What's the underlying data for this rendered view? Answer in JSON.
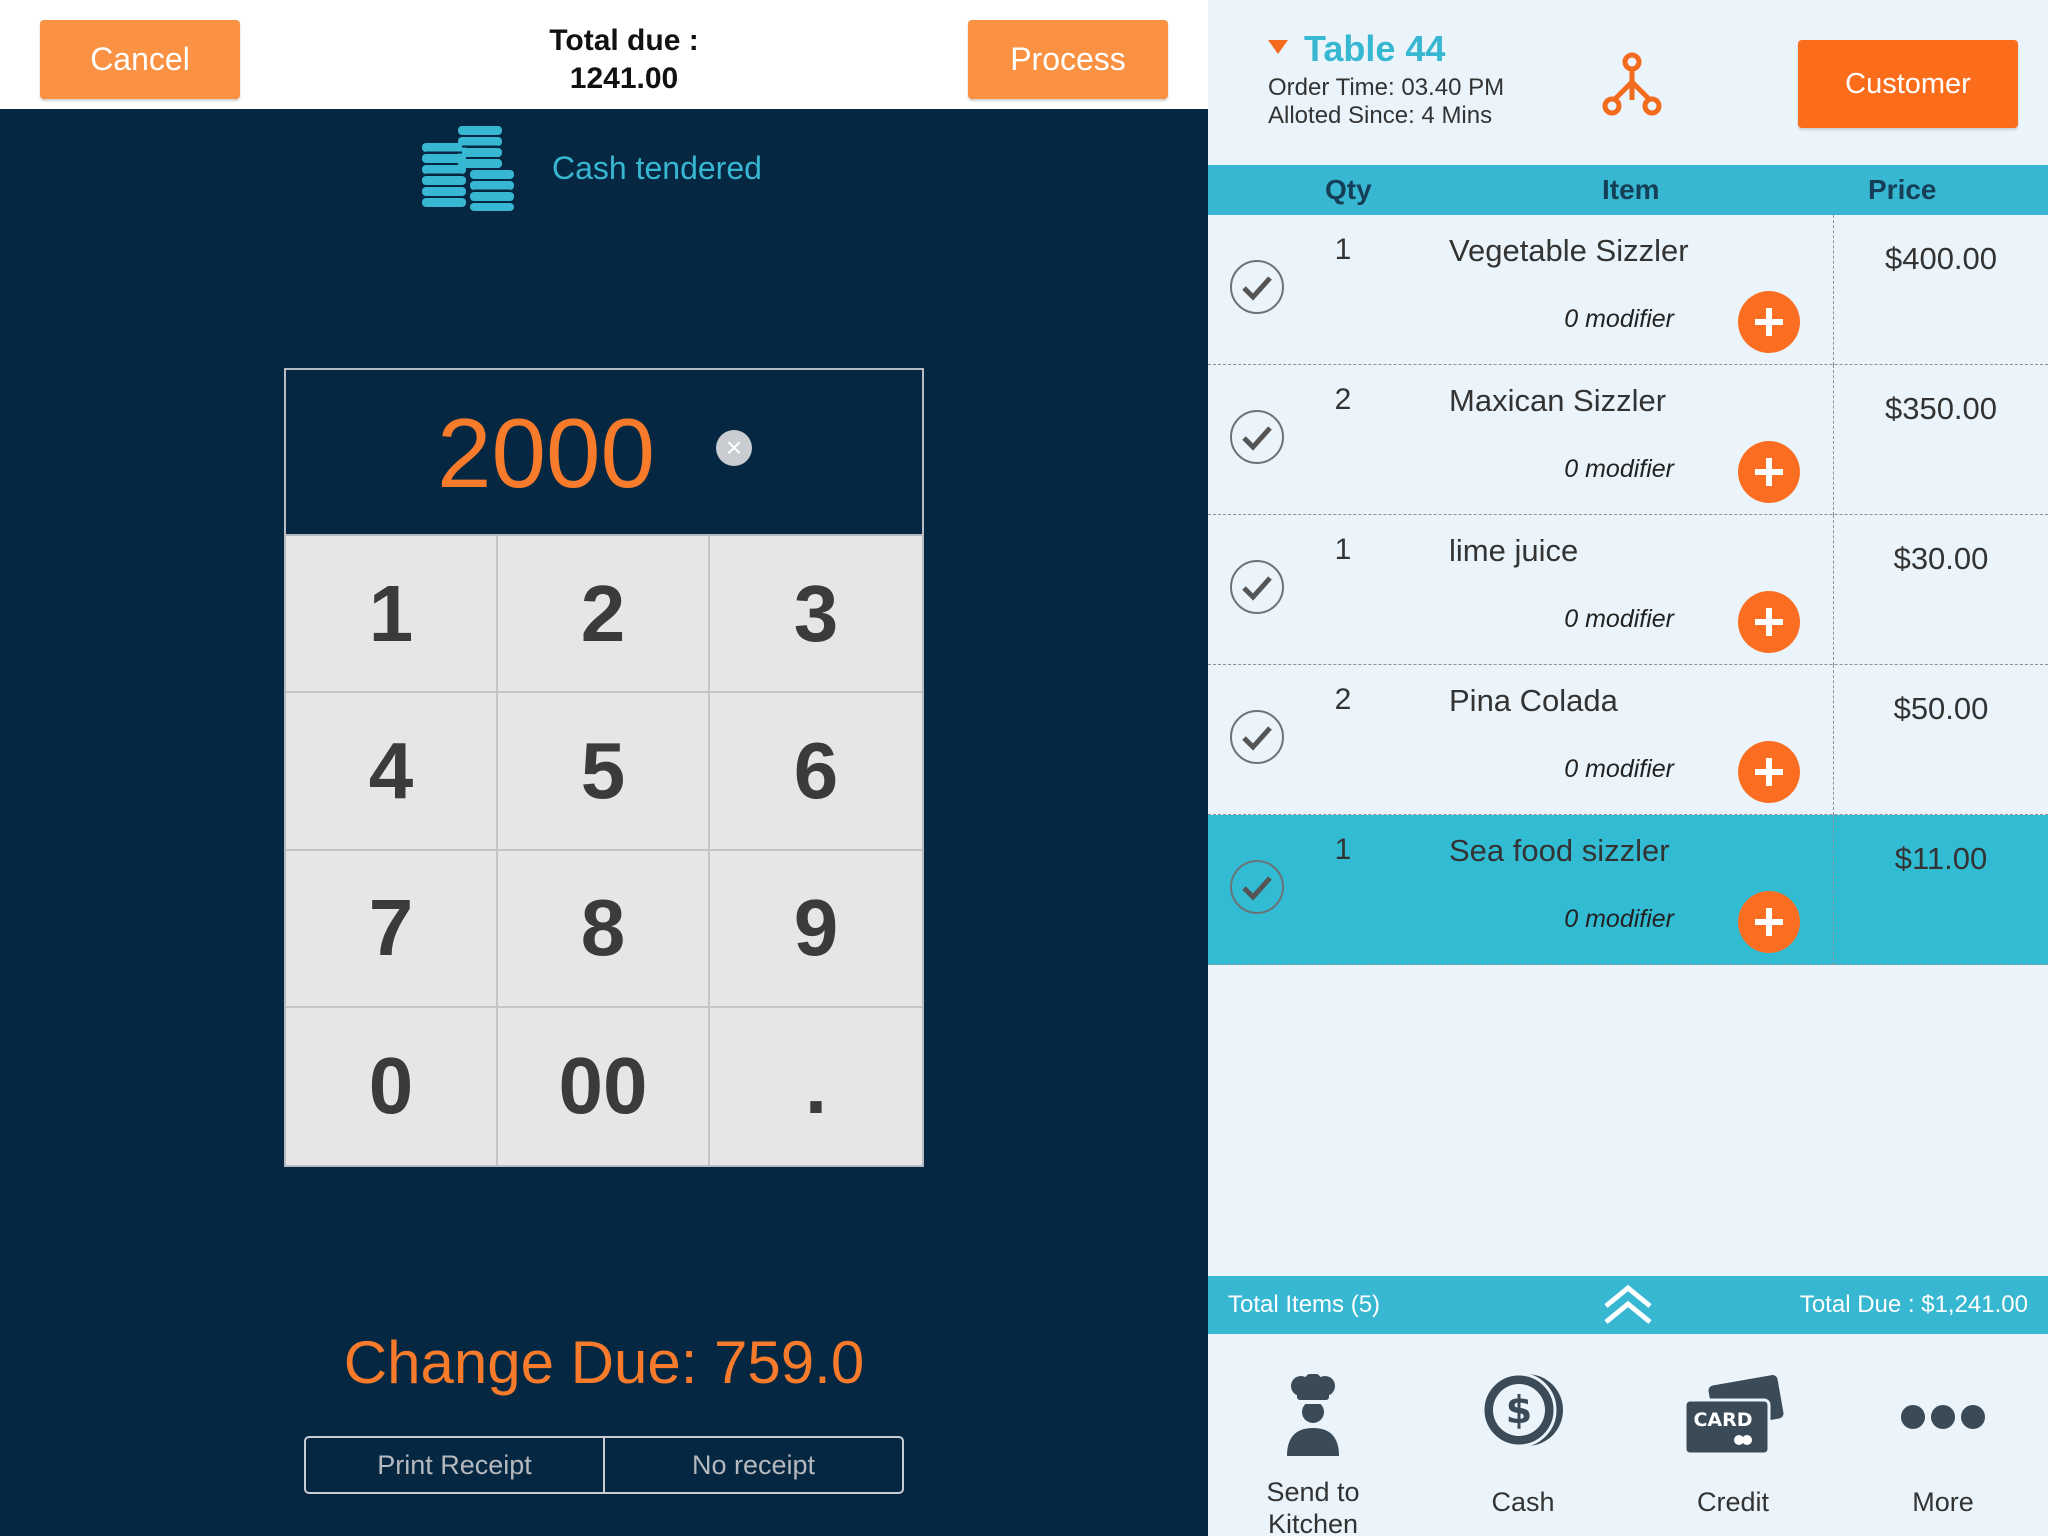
{
  "payment": {
    "cancel_label": "Cancel",
    "process_label": "Process",
    "total_due_label": "Total due :",
    "total_due_value": "1241.00",
    "cash_tendered_label": "Cash tendered",
    "amount_entered": "2000",
    "keys": [
      "1",
      "2",
      "3",
      "4",
      "5",
      "6",
      "7",
      "8",
      "9",
      "0",
      "00",
      "."
    ],
    "change_due": "Change Due: 759.0",
    "print_receipt_label": "Print Receipt",
    "no_receipt_label": "No receipt"
  },
  "order": {
    "table_name": "Table 44",
    "order_time": "Order Time: 03.40 PM",
    "allotted_since": "Alloted Since: 4 Mins",
    "customer_label": "Customer",
    "columns": {
      "qty": "Qty",
      "item": "Item",
      "price": "Price"
    },
    "items": [
      {
        "qty": "1",
        "name": "Vegetable Sizzler",
        "modifier": "0 modifier",
        "price": "$400.00",
        "selected": false
      },
      {
        "qty": "2",
        "name": "Maxican Sizzler",
        "modifier": "0 modifier",
        "price": "$350.00",
        "selected": false
      },
      {
        "qty": "1",
        "name": "lime juice",
        "modifier": "0 modifier",
        "price": "$30.00",
        "selected": false
      },
      {
        "qty": "2",
        "name": "Pina Colada",
        "modifier": "0 modifier",
        "price": "$50.00",
        "selected": false
      },
      {
        "qty": "1",
        "name": "Sea food sizzler",
        "modifier": "0 modifier",
        "price": "$11.00",
        "selected": true
      }
    ],
    "total_items": "Total Items (5)",
    "total_due": "Total Due : $1,241.00",
    "actions": [
      {
        "label": "Send to Kitchen",
        "icon": "chef-icon"
      },
      {
        "label": "Cash",
        "icon": "dollar-coin-icon"
      },
      {
        "label": "Credit",
        "icon": "card-icon"
      },
      {
        "label": "More",
        "icon": "more-dots-icon"
      }
    ]
  },
  "colors": {
    "accent_orange": "#fb9142",
    "customer_orange": "#fc6d1b",
    "teal": "#37b7d1",
    "navy": "#052742",
    "selected_row": "#31bcd3"
  }
}
